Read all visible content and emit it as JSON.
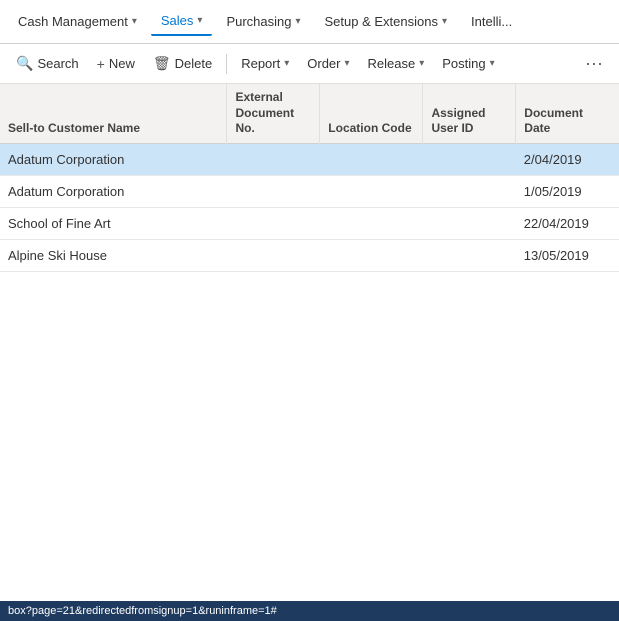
{
  "topNav": {
    "items": [
      {
        "label": "Cash Management",
        "hasChevron": true,
        "active": false
      },
      {
        "label": "Sales",
        "hasChevron": true,
        "active": false
      },
      {
        "label": "Purchasing",
        "hasChevron": true,
        "active": true
      },
      {
        "label": "Setup & Extensions",
        "hasChevron": true,
        "active": false
      },
      {
        "label": "Intelli...",
        "hasChevron": false,
        "active": false
      }
    ]
  },
  "actionBar": {
    "buttons": [
      {
        "label": "Search",
        "icon": "🔍",
        "hasChevron": false
      },
      {
        "label": "New",
        "icon": "+",
        "hasChevron": false
      },
      {
        "label": "Delete",
        "icon": "🗑",
        "hasChevron": false
      },
      {
        "label": "Report",
        "icon": "",
        "hasChevron": true
      },
      {
        "label": "Order",
        "icon": "",
        "hasChevron": true
      },
      {
        "label": "Release",
        "icon": "",
        "hasChevron": true
      },
      {
        "label": "Posting",
        "icon": "",
        "hasChevron": true
      }
    ],
    "more": "···"
  },
  "table": {
    "columns": [
      {
        "key": "name",
        "label": "Sell-to Customer Name"
      },
      {
        "key": "extDoc",
        "label": "External Document No."
      },
      {
        "key": "location",
        "label": "Location Code"
      },
      {
        "key": "assignedUser",
        "label": "Assigned User ID"
      },
      {
        "key": "docDate",
        "label": "Document Date"
      }
    ],
    "rows": [
      {
        "name": "Adatum Corporation",
        "extDoc": "",
        "location": "",
        "assignedUser": "",
        "docDate": "2/04/2019",
        "selected": true
      },
      {
        "name": "Adatum Corporation",
        "extDoc": "",
        "location": "",
        "assignedUser": "",
        "docDate": "1/05/2019",
        "selected": false
      },
      {
        "name": "School of Fine Art",
        "extDoc": "",
        "location": "",
        "assignedUser": "",
        "docDate": "22/04/2019",
        "selected": false
      },
      {
        "name": "Alpine Ski House",
        "extDoc": "",
        "location": "",
        "assignedUser": "",
        "docDate": "13/05/2019",
        "selected": false
      }
    ]
  },
  "statusBar": {
    "url": "box?page=21&redirectedfromsignup=1&runinframe=1#"
  }
}
